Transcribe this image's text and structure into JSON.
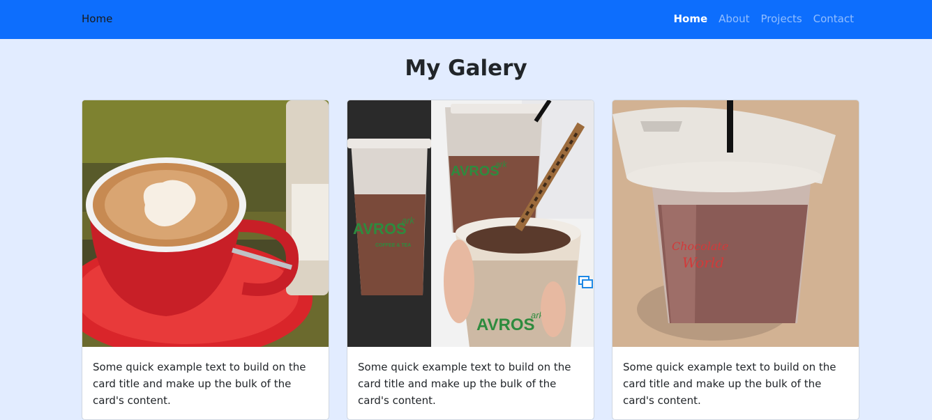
{
  "navbar": {
    "brand": "Home",
    "links": [
      {
        "label": "Home"
      },
      {
        "label": "About"
      },
      {
        "label": "Projects"
      },
      {
        "label": "Contact"
      }
    ]
  },
  "gallery": {
    "title": "My Galery",
    "cards": [
      {
        "image": "latte-art-coffee-photo",
        "text": "Some quick example text to build on the card title and make up the bulk of the card's content."
      },
      {
        "image": "iced-chocolate-drinks-photo",
        "text": "Some quick example text to build on the card title and make up the bulk of the card's content."
      },
      {
        "image": "iced-chocolate-cup-photo",
        "text": "Some quick example text to build on the card title and make up the bulk of the card's content."
      }
    ]
  },
  "image_text": {
    "cup_brand": "AVROS",
    "cup_brand_suffix": "ark",
    "cup_tagline": "COFFEE & TEA",
    "cup3_script_1": "Chocolate",
    "cup3_script_2": "World"
  },
  "colors": {
    "navbar": "#0d6efd",
    "page_background": "#e2ecff",
    "card_background": "#ffffff"
  }
}
